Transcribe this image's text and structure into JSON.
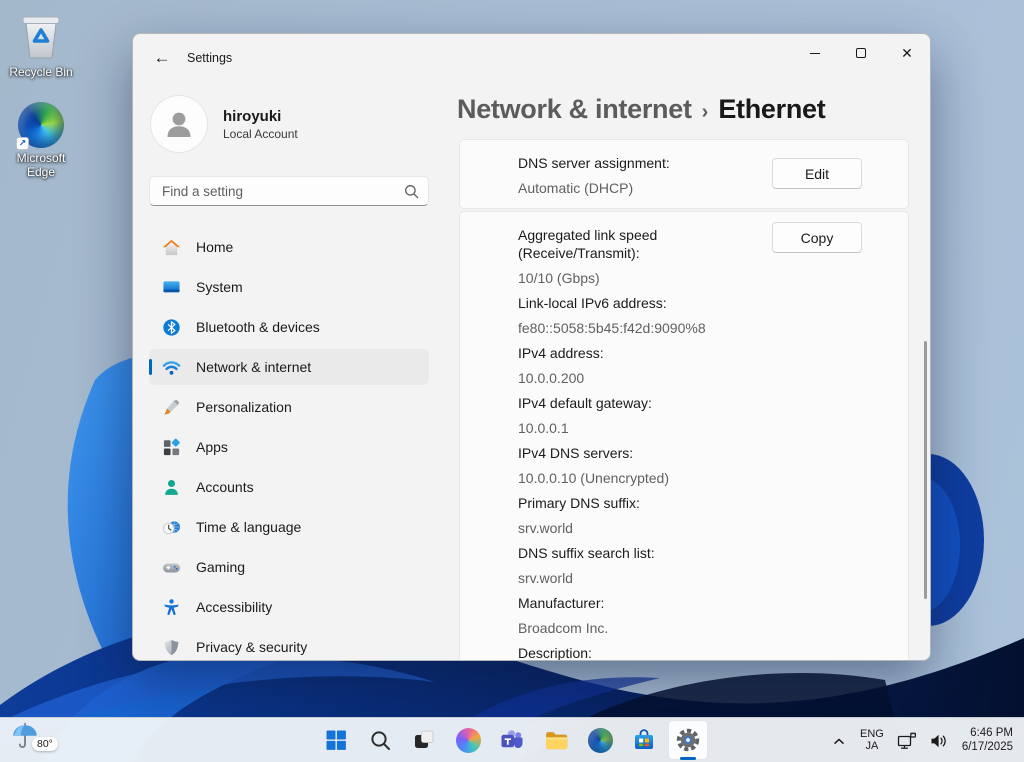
{
  "colors": {
    "accent": "#0067c0"
  },
  "desktop": {
    "icons": [
      {
        "label": "Recycle Bin"
      },
      {
        "label": "Microsoft Edge"
      }
    ],
    "weather": {
      "temp": "80°"
    }
  },
  "window": {
    "titlebar": {
      "title": "Settings"
    },
    "sidebar": {
      "user": {
        "name": "hiroyuki",
        "type": "Local Account"
      },
      "search": {
        "placeholder": "Find a setting"
      },
      "items": [
        {
          "label": "Home"
        },
        {
          "label": "System"
        },
        {
          "label": "Bluetooth & devices"
        },
        {
          "label": "Network & internet"
        },
        {
          "label": "Personalization"
        },
        {
          "label": "Apps"
        },
        {
          "label": "Accounts"
        },
        {
          "label": "Time & language"
        },
        {
          "label": "Gaming"
        },
        {
          "label": "Accessibility"
        },
        {
          "label": "Privacy & security"
        }
      ]
    },
    "content": {
      "breadcrumb": {
        "parent": "Network & internet",
        "separator": "›",
        "current": "Ethernet"
      },
      "cards": [
        {
          "button_label": "Edit",
          "rows": [
            {
              "label": "DNS server assignment:",
              "value": "Automatic (DHCP)"
            }
          ]
        },
        {
          "button_label": "Copy",
          "rows": [
            {
              "label": "Aggregated link speed (Receive/Transmit):",
              "value": "10/10 (Gbps)"
            },
            {
              "label": "Link-local IPv6 address:",
              "value": "fe80::5058:5b45:f42d:9090%8"
            },
            {
              "label": "IPv4 address:",
              "value": "10.0.0.200"
            },
            {
              "label": "IPv4 default gateway:",
              "value": "10.0.0.1"
            },
            {
              "label": "IPv4 DNS servers:",
              "value": "10.0.0.10 (Unencrypted)"
            },
            {
              "label": "Primary DNS suffix:",
              "value": "srv.world"
            },
            {
              "label": "DNS suffix search list:",
              "value": "srv.world"
            },
            {
              "label": "Manufacturer:",
              "value": "Broadcom Inc."
            },
            {
              "label": "Description:",
              "value": ""
            }
          ]
        }
      ]
    }
  },
  "taskbar": {
    "tray": {
      "language_primary": "ENG",
      "language_secondary": "JA",
      "time": "6:46 PM",
      "date": "6/17/2025"
    }
  }
}
